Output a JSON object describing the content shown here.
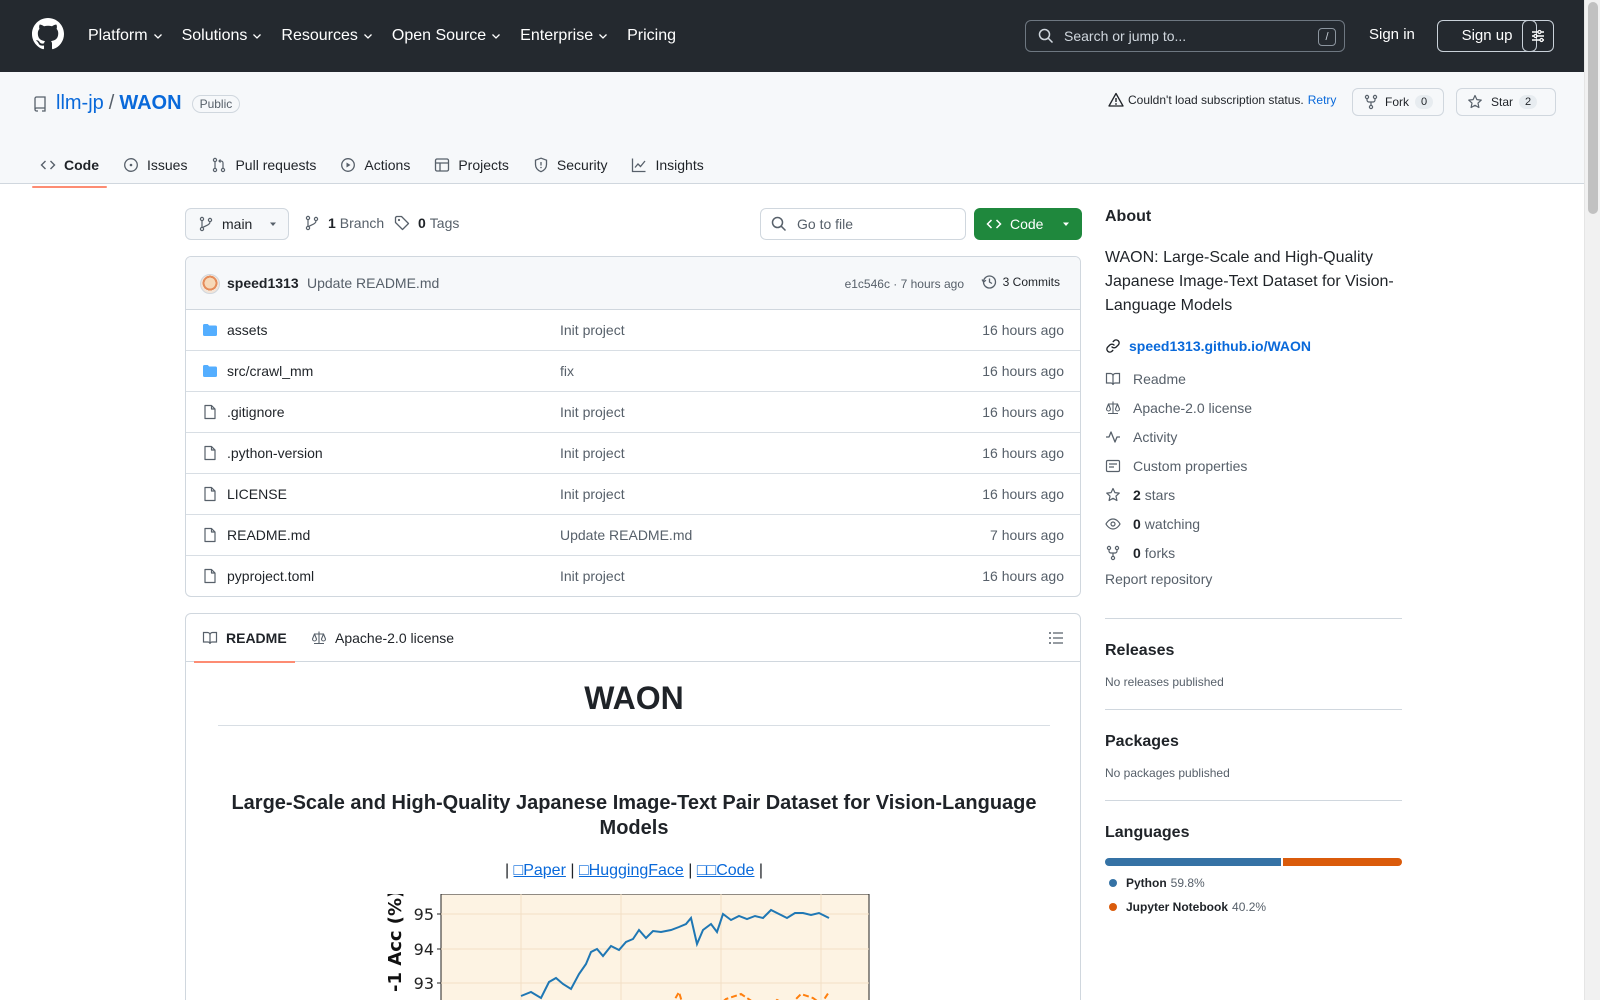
{
  "header": {
    "nav": [
      "Platform",
      "Solutions",
      "Resources",
      "Open Source",
      "Enterprise",
      "Pricing"
    ],
    "search_placeholder": "Search or jump to...",
    "search_key": "/",
    "signin": "Sign in",
    "signup": "Sign up"
  },
  "repo": {
    "owner": "llm-jp",
    "separator": "/",
    "name": "WAON",
    "visibility": "Public",
    "subscription_warning": "Couldn't load subscription status.",
    "retry": "Retry",
    "fork_label": "Fork",
    "fork_count": "0",
    "star_label": "Star",
    "star_count": "2",
    "tabs": [
      "Code",
      "Issues",
      "Pull requests",
      "Actions",
      "Projects",
      "Security",
      "Insights"
    ]
  },
  "toolbar": {
    "branch": "main",
    "branch_count": "1",
    "branch_label": "Branch",
    "tag_count": "0",
    "tag_label": "Tags",
    "go_to_file": "Go to file",
    "code_button": "Code"
  },
  "last_commit": {
    "author": "speed1313",
    "message": "Update README.md",
    "hash_time": "e1c546c · 7 hours ago",
    "commits": "3 Commits"
  },
  "files": [
    {
      "name": "assets",
      "type": "dir",
      "message": "Init project",
      "time": "16 hours ago"
    },
    {
      "name": "src/crawl_mm",
      "type": "dir",
      "message": "fix",
      "time": "16 hours ago"
    },
    {
      "name": ".gitignore",
      "type": "file",
      "message": "Init project",
      "time": "16 hours ago"
    },
    {
      "name": ".python-version",
      "type": "file",
      "message": "Init project",
      "time": "16 hours ago"
    },
    {
      "name": "LICENSE",
      "type": "file",
      "message": "Init project",
      "time": "16 hours ago"
    },
    {
      "name": "README.md",
      "type": "file",
      "message": "Update README.md",
      "time": "7 hours ago"
    },
    {
      "name": "pyproject.toml",
      "type": "file",
      "message": "Init project",
      "time": "16 hours ago"
    }
  ],
  "readme": {
    "tab_readme": "README",
    "tab_license": "Apache-2.0 license",
    "title": "WAON",
    "subtitle": "Large-Scale and High-Quality Japanese Image-Text Pair Dataset for Vision-Language Models",
    "links_pipe": "|",
    "link_paper": "□Paper",
    "link_hf": "□HuggingFace",
    "link_code": "□□Code",
    "chart_ylabel": "-1 Acc (%)",
    "chart_yticks": [
      "95",
      "94",
      "93"
    ]
  },
  "about": {
    "heading": "About",
    "description": "WAON: Large-Scale and High-Quality Japanese Image-Text Dataset for Vision-Language Models",
    "website": "speed1313.github.io/WAON",
    "readme": "Readme",
    "license": "Apache-2.0 license",
    "activity": "Activity",
    "custom_properties": "Custom properties",
    "stars_count": "2",
    "stars_label": "stars",
    "watching_count": "0",
    "watching_label": "watching",
    "forks_count": "0",
    "forks_label": "forks",
    "report": "Report repository"
  },
  "releases": {
    "heading": "Releases",
    "text": "No releases published"
  },
  "packages": {
    "heading": "Packages",
    "text": "No packages published"
  },
  "languages": {
    "heading": "Languages",
    "items": [
      {
        "name": "Python",
        "pct": "59.8%",
        "value": 59.8,
        "color": "#3572A5"
      },
      {
        "name": "Jupyter Notebook",
        "pct": "40.2%",
        "value": 40.2,
        "color": "#DA5B0B"
      }
    ]
  }
}
